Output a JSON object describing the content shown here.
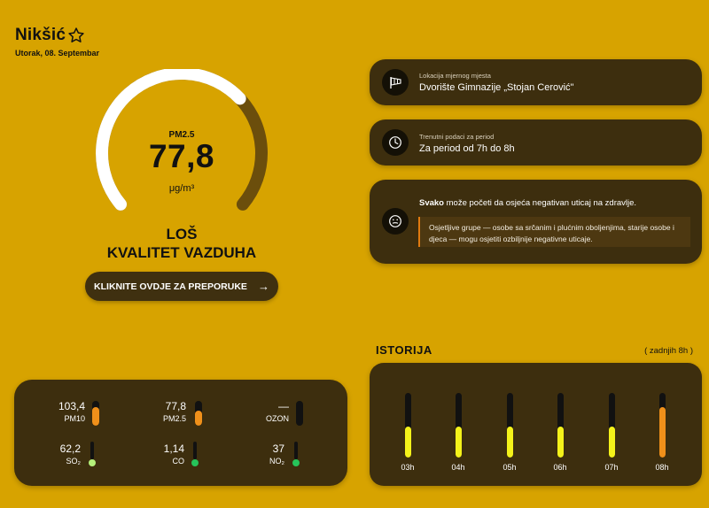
{
  "header": {
    "city": "Nikšić",
    "date": "Utorak, 08. Septembar"
  },
  "gauge": {
    "pollutant": "PM2.5",
    "value": "77,8",
    "unit": "μg/m³",
    "quality_line1": "LOŠ",
    "quality_line2": "KVALITET VAZDUHA",
    "level_fraction": 0.68
  },
  "recommendations_button": {
    "label": "KLIKNITE OVDJE ZA PREPORUKE",
    "arrow": "→"
  },
  "location_card": {
    "label": "Lokacija mjernog mjesta",
    "value": "Dvorište Gimnazije „Stojan Cerović\""
  },
  "period_card": {
    "label": "Trenutni podaci za period",
    "value": "Za period od 7h do 8h"
  },
  "health_card": {
    "headline_bold": "Svako",
    "headline_rest": " može početi da osjeća negativan uticaj na zdravlje.",
    "sensitive_text": "Osjetljive grupe — osobe sa srčanim i plućnim oboljenjima, starije osobe i djeca — mogu osjetiti ozbiljnije negativne uticaje."
  },
  "pollutants": [
    {
      "value": "103,4",
      "name": "PM10",
      "level_fraction": 0.75,
      "color": "#f0901a"
    },
    {
      "value": "77,8",
      "name": "PM2.5",
      "level_fraction": 0.6,
      "color": "#f0901a"
    },
    {
      "value": "—",
      "name": "OZON",
      "level_fraction": 0,
      "color": "#111111"
    },
    {
      "value": "62,2",
      "name": "SO₂",
      "color": "#b5f07a"
    },
    {
      "value": "1,14",
      "name": "CO",
      "color": "#26c45a"
    },
    {
      "value": "37",
      "name": "NO₂",
      "color": "#26c45a"
    }
  ],
  "history": {
    "title": "ISTORIJA",
    "range": "( zadnjih 8h )",
    "bars": [
      {
        "label": "03h",
        "level_fraction": 0.48,
        "color": "#f4f21a"
      },
      {
        "label": "04h",
        "level_fraction": 0.48,
        "color": "#f4f21a"
      },
      {
        "label": "05h",
        "level_fraction": 0.48,
        "color": "#f4f21a"
      },
      {
        "label": "06h",
        "level_fraction": 0.48,
        "color": "#f4f21a"
      },
      {
        "label": "07h",
        "level_fraction": 0.48,
        "color": "#f4f21a"
      },
      {
        "label": "08h",
        "level_fraction": 0.78,
        "color": "#f0901a"
      }
    ]
  },
  "colors": {
    "background": "#d7a300",
    "card": "#3d2e0e",
    "gauge_track": "#6b4e0c",
    "gauge_fill": "#ffffff"
  }
}
